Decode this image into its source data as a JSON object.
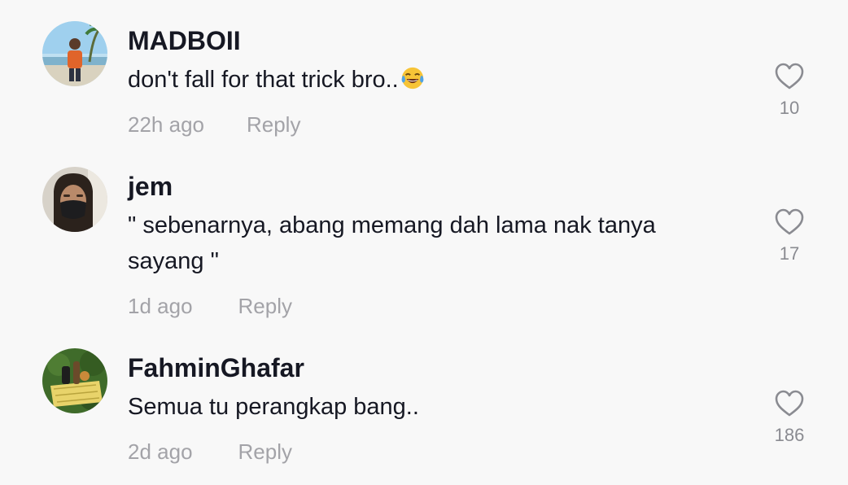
{
  "comments": [
    {
      "username": "MADBOII",
      "text": "don't fall for that trick bro..",
      "emoji": "face-with-tears-of-joy",
      "time": "22h ago",
      "reply_label": "Reply",
      "likes": "10"
    },
    {
      "username": "jem",
      "text": "\" sebenarnya, abang memang dah lama nak tanya sayang \"",
      "time": "1d ago",
      "reply_label": "Reply",
      "likes": "17"
    },
    {
      "username": "FahminGhafar",
      "text": "Semua tu perangkap bang..",
      "time": "2d ago",
      "reply_label": "Reply",
      "likes": "186"
    }
  ],
  "icons": {
    "like": "heart-outline-icon"
  },
  "colors": {
    "background": "#f8f8f8",
    "username": "#161823",
    "meta": "#a3a3a8",
    "like_count": "#8a8b91"
  }
}
